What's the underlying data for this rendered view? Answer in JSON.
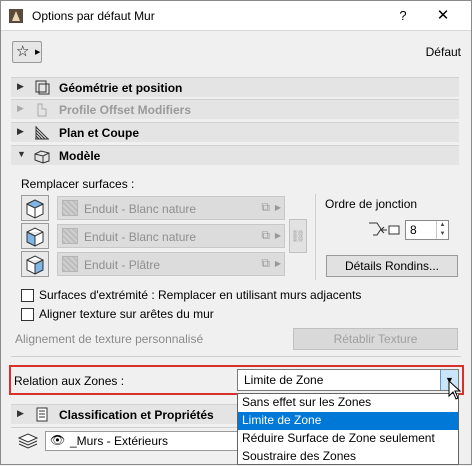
{
  "window": {
    "title": "Options par défaut Mur",
    "help": "?",
    "close": "✕"
  },
  "toolbar": {
    "default_label": "Défaut"
  },
  "panels": [
    {
      "label": "Géométrie et position",
      "state": "collapsed"
    },
    {
      "label": "Profile Offset Modifiers",
      "state": "collapsed-disabled"
    },
    {
      "label": "Plan et Coupe",
      "state": "collapsed"
    },
    {
      "label": "Modèle",
      "state": "expanded"
    }
  ],
  "model": {
    "override_label": "Remplacer surfaces :",
    "surfaces": [
      {
        "name": "Enduit - Blanc nature"
      },
      {
        "name": "Enduit - Blanc nature"
      },
      {
        "name": "Enduit - Plâtre"
      }
    ],
    "junction_label": "Ordre de jonction",
    "junction_value": "8",
    "details_button": "Détails Rondins...",
    "checkbox_end_surfaces": "Surfaces d'extrémité : Remplacer en utilisant murs adjacents",
    "checkbox_align_texture": "Aligner texture sur arêtes du mur",
    "custom_texture_label": "Alignement de texture personnalisé",
    "reset_texture_button": "Rétablir Texture"
  },
  "zones": {
    "label": "Relation aux Zones :",
    "selected": "Limite de Zone",
    "options": [
      "Sans effet sur les Zones",
      "Limite de Zone",
      "Réduire Surface de Zone seulement",
      "Soustraire des Zones"
    ],
    "highlight_color": "#d9302c",
    "selection_color": "#0078d7"
  },
  "classification": {
    "label": "Classification et Propriétés"
  },
  "layer": {
    "value": "_Murs - Extérieurs"
  }
}
